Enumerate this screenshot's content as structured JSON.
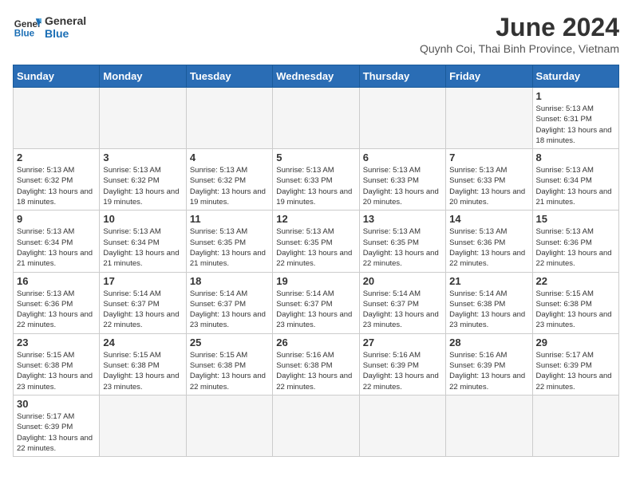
{
  "logo": {
    "text_general": "General",
    "text_blue": "Blue"
  },
  "header": {
    "month_year": "June 2024",
    "location": "Quynh Coi, Thai Binh Province, Vietnam"
  },
  "weekdays": [
    "Sunday",
    "Monday",
    "Tuesday",
    "Wednesday",
    "Thursday",
    "Friday",
    "Saturday"
  ],
  "weeks": [
    [
      {
        "day": "",
        "info": ""
      },
      {
        "day": "",
        "info": ""
      },
      {
        "day": "",
        "info": ""
      },
      {
        "day": "",
        "info": ""
      },
      {
        "day": "",
        "info": ""
      },
      {
        "day": "",
        "info": ""
      },
      {
        "day": "1",
        "info": "Sunrise: 5:13 AM\nSunset: 6:31 PM\nDaylight: 13 hours and 18 minutes."
      }
    ],
    [
      {
        "day": "2",
        "info": "Sunrise: 5:13 AM\nSunset: 6:32 PM\nDaylight: 13 hours and 18 minutes."
      },
      {
        "day": "3",
        "info": "Sunrise: 5:13 AM\nSunset: 6:32 PM\nDaylight: 13 hours and 19 minutes."
      },
      {
        "day": "4",
        "info": "Sunrise: 5:13 AM\nSunset: 6:32 PM\nDaylight: 13 hours and 19 minutes."
      },
      {
        "day": "5",
        "info": "Sunrise: 5:13 AM\nSunset: 6:33 PM\nDaylight: 13 hours and 19 minutes."
      },
      {
        "day": "6",
        "info": "Sunrise: 5:13 AM\nSunset: 6:33 PM\nDaylight: 13 hours and 20 minutes."
      },
      {
        "day": "7",
        "info": "Sunrise: 5:13 AM\nSunset: 6:33 PM\nDaylight: 13 hours and 20 minutes."
      },
      {
        "day": "8",
        "info": "Sunrise: 5:13 AM\nSunset: 6:34 PM\nDaylight: 13 hours and 21 minutes."
      }
    ],
    [
      {
        "day": "9",
        "info": "Sunrise: 5:13 AM\nSunset: 6:34 PM\nDaylight: 13 hours and 21 minutes."
      },
      {
        "day": "10",
        "info": "Sunrise: 5:13 AM\nSunset: 6:34 PM\nDaylight: 13 hours and 21 minutes."
      },
      {
        "day": "11",
        "info": "Sunrise: 5:13 AM\nSunset: 6:35 PM\nDaylight: 13 hours and 21 minutes."
      },
      {
        "day": "12",
        "info": "Sunrise: 5:13 AM\nSunset: 6:35 PM\nDaylight: 13 hours and 22 minutes."
      },
      {
        "day": "13",
        "info": "Sunrise: 5:13 AM\nSunset: 6:35 PM\nDaylight: 13 hours and 22 minutes."
      },
      {
        "day": "14",
        "info": "Sunrise: 5:13 AM\nSunset: 6:36 PM\nDaylight: 13 hours and 22 minutes."
      },
      {
        "day": "15",
        "info": "Sunrise: 5:13 AM\nSunset: 6:36 PM\nDaylight: 13 hours and 22 minutes."
      }
    ],
    [
      {
        "day": "16",
        "info": "Sunrise: 5:13 AM\nSunset: 6:36 PM\nDaylight: 13 hours and 22 minutes."
      },
      {
        "day": "17",
        "info": "Sunrise: 5:14 AM\nSunset: 6:37 PM\nDaylight: 13 hours and 22 minutes."
      },
      {
        "day": "18",
        "info": "Sunrise: 5:14 AM\nSunset: 6:37 PM\nDaylight: 13 hours and 23 minutes."
      },
      {
        "day": "19",
        "info": "Sunrise: 5:14 AM\nSunset: 6:37 PM\nDaylight: 13 hours and 23 minutes."
      },
      {
        "day": "20",
        "info": "Sunrise: 5:14 AM\nSunset: 6:37 PM\nDaylight: 13 hours and 23 minutes."
      },
      {
        "day": "21",
        "info": "Sunrise: 5:14 AM\nSunset: 6:38 PM\nDaylight: 13 hours and 23 minutes."
      },
      {
        "day": "22",
        "info": "Sunrise: 5:15 AM\nSunset: 6:38 PM\nDaylight: 13 hours and 23 minutes."
      }
    ],
    [
      {
        "day": "23",
        "info": "Sunrise: 5:15 AM\nSunset: 6:38 PM\nDaylight: 13 hours and 23 minutes."
      },
      {
        "day": "24",
        "info": "Sunrise: 5:15 AM\nSunset: 6:38 PM\nDaylight: 13 hours and 23 minutes."
      },
      {
        "day": "25",
        "info": "Sunrise: 5:15 AM\nSunset: 6:38 PM\nDaylight: 13 hours and 22 minutes."
      },
      {
        "day": "26",
        "info": "Sunrise: 5:16 AM\nSunset: 6:38 PM\nDaylight: 13 hours and 22 minutes."
      },
      {
        "day": "27",
        "info": "Sunrise: 5:16 AM\nSunset: 6:39 PM\nDaylight: 13 hours and 22 minutes."
      },
      {
        "day": "28",
        "info": "Sunrise: 5:16 AM\nSunset: 6:39 PM\nDaylight: 13 hours and 22 minutes."
      },
      {
        "day": "29",
        "info": "Sunrise: 5:17 AM\nSunset: 6:39 PM\nDaylight: 13 hours and 22 minutes."
      }
    ],
    [
      {
        "day": "30",
        "info": "Sunrise: 5:17 AM\nSunset: 6:39 PM\nDaylight: 13 hours and 22 minutes."
      },
      {
        "day": "",
        "info": ""
      },
      {
        "day": "",
        "info": ""
      },
      {
        "day": "",
        "info": ""
      },
      {
        "day": "",
        "info": ""
      },
      {
        "day": "",
        "info": ""
      },
      {
        "day": "",
        "info": ""
      }
    ]
  ]
}
